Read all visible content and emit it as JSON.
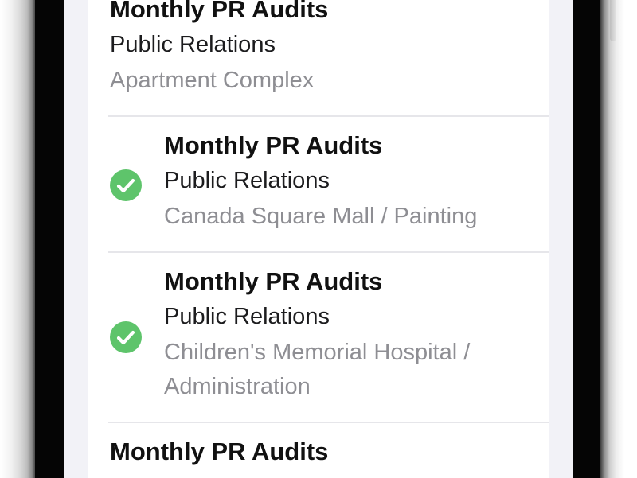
{
  "tasks": [
    {
      "title": "Monthly PR Audits",
      "department": "Public Relations",
      "location": "Apartment Complex",
      "completed": false
    },
    {
      "title": "Monthly PR Audits",
      "department": "Public Relations",
      "location": "Canada Square Mall / Painting",
      "completed": true
    },
    {
      "title": "Monthly PR Audits",
      "department": "Public Relations",
      "location": "Children's Memorial Hospital / Administration",
      "completed": true
    },
    {
      "title": "Monthly PR Audits",
      "department": "",
      "location": "",
      "completed": false
    }
  ],
  "colors": {
    "check": "#5ec46b",
    "title": "#111111",
    "secondary": "#8e8e93"
  },
  "icons": {
    "completed": "checkmark-circle-icon"
  }
}
